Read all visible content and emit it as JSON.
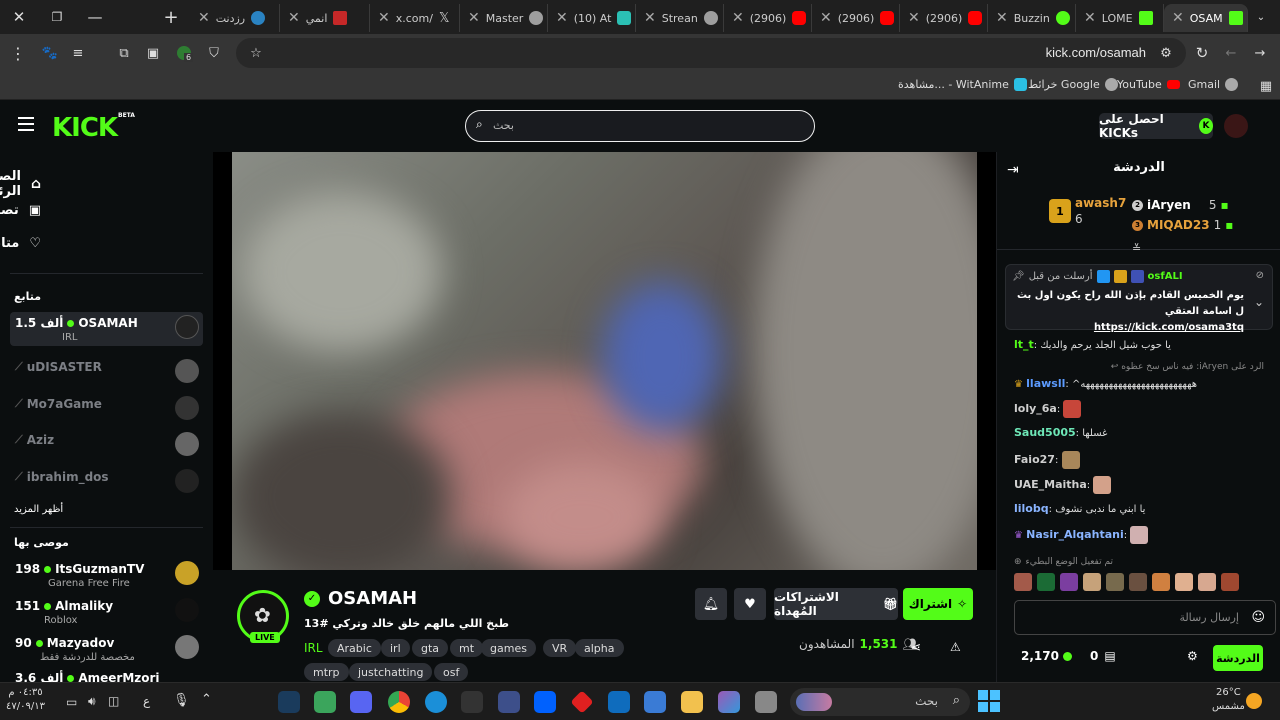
{
  "browser": {
    "tabs": [
      {
        "label": "رزدنت",
        "icon_color": "#2a83c2"
      },
      {
        "label": "انمي",
        "icon_color": "#c62828"
      },
      {
        "label": "x.com/",
        "icon_color": "#000000"
      },
      {
        "label": "Master",
        "icon_color": "#9e9e9e"
      },
      {
        "label": "(10) At",
        "icon_color": "#2bc0b4"
      },
      {
        "label": "Strean",
        "icon_color": "#9e9e9e"
      },
      {
        "label": "(2906)",
        "icon_color": "#ff0000"
      },
      {
        "label": "(2906)",
        "icon_color": "#ff0000"
      },
      {
        "label": "(2906)",
        "icon_color": "#ff0000"
      },
      {
        "label": "Buzzin",
        "icon_color": "#53fc18"
      },
      {
        "label": "LOME",
        "icon_color": "#53fc18"
      },
      {
        "label": "OSAM",
        "icon_color": "#53fc18"
      }
    ],
    "url": "kick.com/osamah",
    "extension_badge": "6",
    "bookmarks": [
      {
        "label": "Gmail",
        "icon": "gmail-icon"
      },
      {
        "label": "YouTube",
        "icon": "youtube-icon"
      },
      {
        "label": "خرائط Google",
        "icon": "maps-icon"
      },
      {
        "label": "مشاهدة... - WitAnime",
        "icon": "witanime-icon"
      }
    ]
  },
  "header": {
    "logo": "KICK",
    "beta": "BETA",
    "search_placeholder": "بحث",
    "get_kicks": "احصل على KICKs"
  },
  "sidebar": {
    "nav": [
      {
        "label": "الصفحة الرئيسية",
        "icon": "home-icon"
      },
      {
        "label": "تصفح",
        "icon": "browse-icon"
      },
      {
        "label": "متابع",
        "icon": "heart-icon"
      }
    ],
    "following_title": "متابع",
    "following": [
      {
        "name": "OSAMAH",
        "count": "1.5 ألف",
        "sub": "IRL",
        "live": true
      },
      {
        "name": "uDISASTER",
        "live": false
      },
      {
        "name": "Mo7aGame",
        "live": false
      },
      {
        "name": "Aziz",
        "live": false
      },
      {
        "name": "ibrahim_dos",
        "live": false
      }
    ],
    "show_more": "أظهر المزيد",
    "recommended_title": "موصى بها",
    "recommended": [
      {
        "name": "ItsGuzmanTV",
        "count": "198",
        "sub": "Garena Free Fire"
      },
      {
        "name": "Almaliky",
        "count": "151",
        "sub": "Roblox"
      },
      {
        "name": "Mazyadov",
        "count": "90",
        "sub": "مخصصة للدردشة فقط"
      },
      {
        "name": "AmeerMzori",
        "count": "3.6 ألف",
        "sub": ""
      }
    ]
  },
  "stream": {
    "streamer": "OSAMAH",
    "live_badge": "LIVE",
    "title": "طبخ اللي مالهم خلق خالد وتركي #13",
    "category": "IRL",
    "tags": [
      "Arabic",
      "irl",
      "gta",
      "mt",
      "games",
      "VR",
      "alpha",
      "mtrp",
      "justchatting",
      "osf"
    ],
    "subscribe": "اشتراك",
    "gift_subs": "الاشتراكات المُهداة",
    "viewers_label": "المشاهدون",
    "viewers": "1,531"
  },
  "chat": {
    "title": "الدردشة",
    "leaderboard": [
      {
        "name": "awash7",
        "count": "6",
        "rank": ""
      },
      {
        "name": "iAryen",
        "count": "5",
        "rank": "2"
      },
      {
        "name": "MIQAD23",
        "count": "1",
        "rank": "3"
      }
    ],
    "pinned": {
      "sent_by_label": "أرسلت من قبل",
      "user": "osfALI",
      "text": "يوم الخميس القادم بإذن الله راح يكون اول بث ل اسامة العتقي",
      "link": "https://kick.com/osama3tq"
    },
    "messages": [
      {
        "user": "lt_t",
        "text": "يا حوب شيل الجلد يرحم والديك",
        "color": "#53fc18"
      },
      {
        "user": "الرد على iAryen",
        "text": "فيه ناس سخ عظوه",
        "color": "#888888",
        "reply": true
      },
      {
        "user": "llawsll",
        "text": "^‏‏‏‏ههههههههههههههههههههههههه",
        "color": "#5c9bff"
      },
      {
        "user": "loly_6a",
        "text": "",
        "color": "#cfcfcf"
      },
      {
        "user": "Saud5005",
        "text": "غسلها",
        "color": "#6ee7b7"
      },
      {
        "user": "Faio27",
        "text": "",
        "color": "#cfcfcf"
      },
      {
        "user": "UAE_Maitha",
        "text": "",
        "color": "#cfcfcf"
      },
      {
        "user": "lilobq",
        "text": "يا ابني ما ندبى نشوف",
        "color": "#8ab4ff"
      },
      {
        "user": "Nasir_Alqahtani",
        "text": "",
        "color": "#8ab4ff"
      }
    ],
    "slow_mode": "تم تفعيل الوضع البطيء",
    "input_placeholder": "إرسال رسالة",
    "points": "2,170",
    "kicks": "0",
    "send": "الدردشة"
  },
  "taskbar": {
    "search": "بحث",
    "time": "٠٤:٣٥ م",
    "date": "٤٧/٠٩/١٣",
    "lang": "ع",
    "temp": "26°C",
    "weather": "مشمس"
  }
}
